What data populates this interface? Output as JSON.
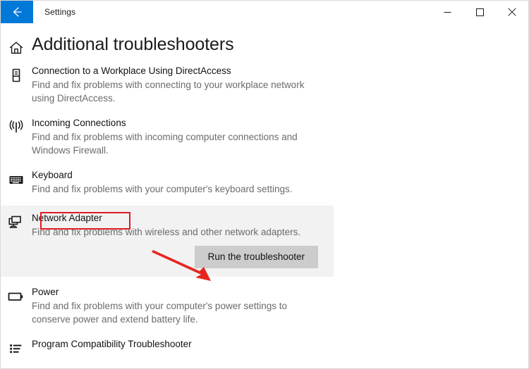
{
  "window": {
    "title": "Settings",
    "back_icon": "back-arrow-icon",
    "minimize_label": "─",
    "maximize_label": "□",
    "close_label": "✕",
    "accent_color": "#0078d7"
  },
  "page": {
    "home_icon": "home-icon",
    "title": "Additional troubleshooters"
  },
  "troubleshooters": [
    {
      "icon": "mobile-device-icon",
      "name": "Connection to a Workplace Using DirectAccess",
      "description": "Find and fix problems with connecting to your workplace network using DirectAccess.",
      "selected": false
    },
    {
      "icon": "broadcast-antenna-icon",
      "name": "Incoming Connections",
      "description": "Find and fix problems with incoming computer connections and Windows Firewall.",
      "selected": false
    },
    {
      "icon": "keyboard-icon",
      "name": "Keyboard",
      "description": "Find and fix problems with your computer's keyboard settings.",
      "selected": false
    },
    {
      "icon": "network-adapter-icon",
      "name": "Network Adapter",
      "description": "Find and fix problems with wireless and other network adapters.",
      "selected": true,
      "action_label": "Run the troubleshooter"
    },
    {
      "icon": "battery-icon",
      "name": "Power",
      "description": "Find and fix problems with your computer's power settings to conserve power and extend battery life.",
      "selected": false
    },
    {
      "icon": "list-icon",
      "name": "Program Compatibility Troubleshooter",
      "description": "",
      "selected": false
    }
  ],
  "annotations": {
    "highlight_color": "#e01b24",
    "box_target": "Network Adapter",
    "arrow_target": "Run the troubleshooter"
  }
}
